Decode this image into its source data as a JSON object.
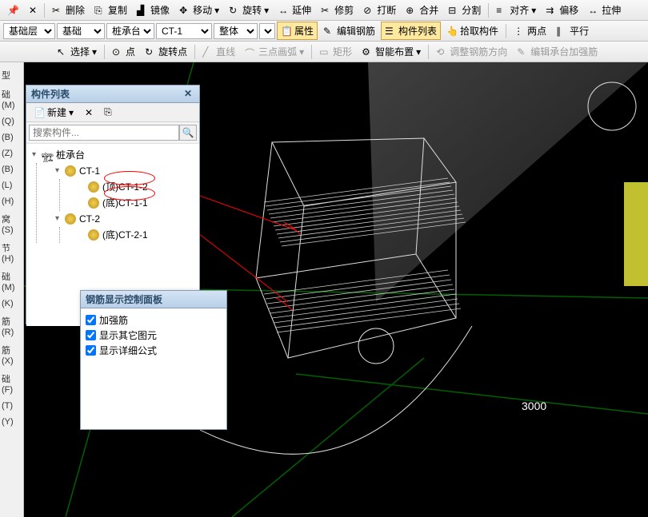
{
  "toolbar1": {
    "pin_icon": "📌",
    "delete": "删除",
    "copy": "复制",
    "mirror": "镜像",
    "move": "移动",
    "rotate": "旋转",
    "extend": "延伸",
    "trim": "修剪",
    "break": "打断",
    "merge": "合并",
    "split": "分割",
    "align": "对齐",
    "offset": "偏移",
    "stretch": "拉伸"
  },
  "toolbar2": {
    "layer_label": "基础层",
    "foundation": "基础",
    "pile_cap": "桩承台",
    "component": "CT-1",
    "whole": "整体",
    "properties": "属性",
    "edit_rebar": "编辑钢筋",
    "component_list": "构件列表",
    "pick_component": "拾取构件",
    "two_points": "两点",
    "parallel": "平行"
  },
  "toolbar3": {
    "select": "选择",
    "point": "点",
    "rotate_point": "旋转点",
    "line": "直线",
    "arc_3pt": "三点画弧",
    "rect": "矩形",
    "smart_layout": "智能布置",
    "adjust_rebar_dir": "调整钢筋方向",
    "edit_cap_rebar": "编辑承台加强筋"
  },
  "left_sidebar_items": [
    "型",
    "础(M)",
    "(Q)",
    "(B)",
    "(Z)",
    "(B)",
    "(L)",
    "(H)",
    "窝(S)",
    "节(H)",
    "础(M)",
    "(K)",
    "筋(R)",
    "筋(X)",
    "础(F)",
    "(T)",
    "(Y)"
  ],
  "component_panel": {
    "title": "构件列表",
    "new_btn": "新建",
    "search_placeholder": "搜索构件...",
    "tree": {
      "root": "桩承台",
      "ct1": "CT-1",
      "ct1_top": "(顶)CT-1-2",
      "ct1_bot": "(底)CT-1-1",
      "ct2": "CT-2",
      "ct2_bot": "(底)CT-2-1"
    }
  },
  "control_panel": {
    "title": "钢筋显示控制面板",
    "opt1": "加强筋",
    "opt2": "显示其它图元",
    "opt3": "显示详细公式"
  },
  "canvas": {
    "dim_label": "3000"
  }
}
